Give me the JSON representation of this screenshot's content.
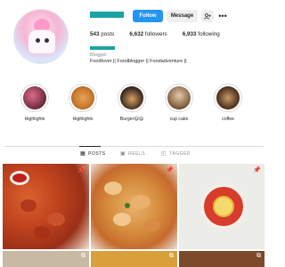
{
  "profile": {
    "follow_label": "Follow",
    "message_label": "Message",
    "person_add_icon": "person-add-icon",
    "more_icon_text": "•••",
    "stats": {
      "posts": "543",
      "posts_label": "posts",
      "followers": "6,632",
      "followers_label": "followers",
      "following": "6,933",
      "following_label": "following"
    },
    "category": "Blogger",
    "bio": "Foodlover || Foodblogger || Foodadventure ||"
  },
  "highlights": [
    {
      "label": "Highlights",
      "color": "#6b2a3a"
    },
    {
      "label": "Highlights",
      "color": "#c8782a"
    },
    {
      "label": "Burger😋😋",
      "color": "#3a2a22"
    },
    {
      "label": "cup cake",
      "color": "#8a6a4a"
    },
    {
      "label": "coffee",
      "color": "#5a3a22"
    }
  ],
  "tabs": [
    {
      "label": "POSTS",
      "icon": "grid-icon",
      "active": true
    },
    {
      "label": "REELS",
      "icon": "reels-icon",
      "active": false
    },
    {
      "label": "TAGGED",
      "icon": "tag-icon",
      "active": false
    }
  ],
  "colors": {
    "accent_follow": "#2196f3",
    "redacted_bar": "#1aa3a3"
  }
}
